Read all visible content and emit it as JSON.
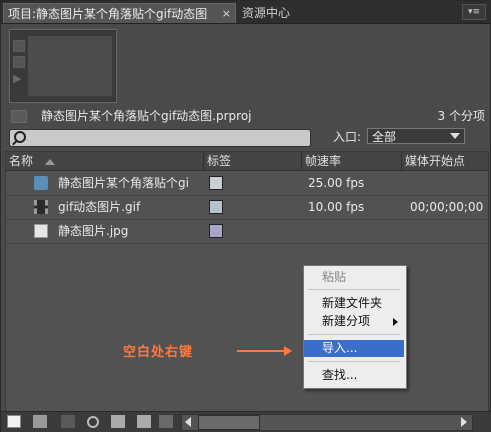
{
  "tabs": {
    "project_label": "项目:静态图片某个角落贴个gif动态图",
    "close_glyph": "×",
    "media_browser_label": "资源中心",
    "panel_menu_glyph": "▾≡"
  },
  "project": {
    "file_name": "静态图片某个角落贴个gif动态图.prproj",
    "item_count": "3 个分项"
  },
  "filter": {
    "entry_label": "入口:",
    "entry_value": "全部"
  },
  "columns": {
    "name": "名称",
    "label": "标签",
    "frame_rate": "帧速率",
    "media_start": "媒体开始点"
  },
  "rows": [
    {
      "name": "静态图片某个角落贴个gi",
      "icon": "sequence-icon",
      "label_color": "#c8d0d4",
      "frame_rate": "25.00 fps",
      "media_start": ""
    },
    {
      "name": "gif动态图片.gif",
      "icon": "film-icon",
      "label_color": "#b5c4cc",
      "frame_rate": "10.00 fps",
      "media_start": "00;00;00;00"
    },
    {
      "name": "静态图片.jpg",
      "icon": "image-icon",
      "label_color": "#a8a6c8",
      "frame_rate": "",
      "media_start": ""
    }
  ],
  "context_menu": {
    "paste": "粘贴",
    "new_folder": "新建文件夹",
    "new_item": "新建分项",
    "import": "导入...",
    "find": "查找..."
  },
  "annotation": {
    "text": "空白处右键",
    "color": "#ff7a3a"
  }
}
